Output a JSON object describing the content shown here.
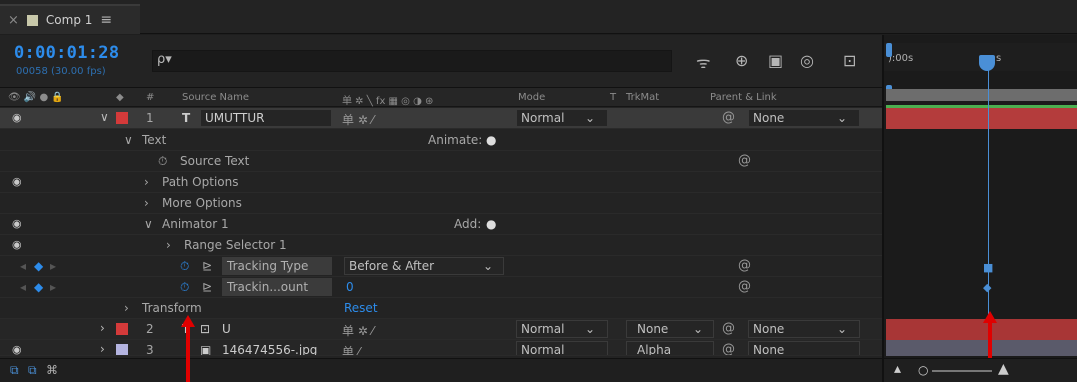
{
  "tab": {
    "close": "×",
    "title": "Comp 1",
    "menu": "≡"
  },
  "time": {
    "timecode": "0:00:01:28",
    "frames": "00058 (30.00 fps)"
  },
  "search": {
    "icon": "ρ▾",
    "placeholder": ""
  },
  "columns": {
    "switches": "👁 🔊 ● 🔒",
    "label": "◆",
    "num": "#",
    "source_name": "Source Name",
    "layer_switches": "单 ✲ ╲ fx ▦ ◎ ◑ ⊛",
    "mode": "Mode",
    "t": "T",
    "trkmat": "TrkMat",
    "parent": "Parent & Link"
  },
  "layers": [
    {
      "num": "1",
      "type_icon": "T",
      "name": "UMUTTUR",
      "mode": "Normal",
      "parent": "None",
      "label_color": "#d43a3a"
    },
    {
      "num": "2",
      "type_icon": "T",
      "name": "U",
      "mode": "Normal",
      "trkmat": "None",
      "parent": "None",
      "label_color": "#d43a3a"
    },
    {
      "num": "3",
      "name": "146474556-.jpg",
      "mode": "Normal",
      "trkmat": "Alpha",
      "parent": "None",
      "label_color": "#b4b4e0"
    }
  ],
  "props": {
    "text": "Text",
    "animate": "Animate:",
    "source_text": "Source Text",
    "path_options": "Path Options",
    "more_options": "More Options",
    "animator": "Animator 1",
    "add": "Add:",
    "range_selector": "Range Selector 1",
    "tracking_type": "Tracking Type",
    "tracking_type_value": "Before & After",
    "tracking_amount": "Trackin...ount",
    "tracking_amount_value": "0",
    "transform": "Transform",
    "reset": "Reset"
  },
  "timeline": {
    "ruler_start": "):00s",
    "ruler_mark": "s"
  },
  "colors": {
    "accent_blue": "#2d8ceb",
    "layer_red": "#d43a3a",
    "arrow_red": "#e00000"
  }
}
